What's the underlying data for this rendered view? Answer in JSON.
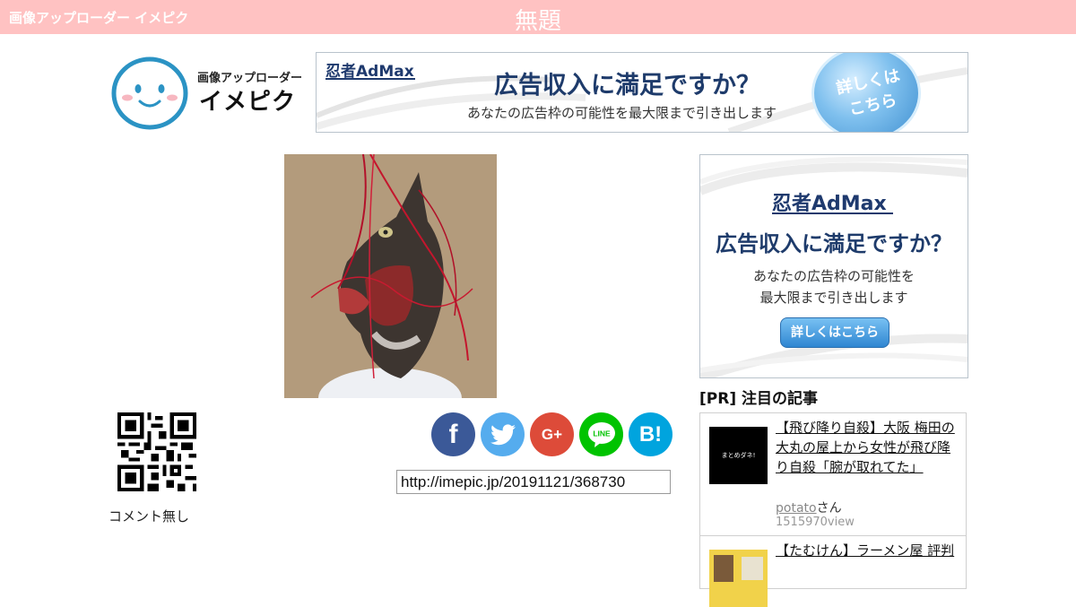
{
  "header": {
    "site_name": "画像アップローダー イメピク",
    "page_title": "無題"
  },
  "logo": {
    "small_text": "画像アップローダー",
    "big_text": "イメピク"
  },
  "top_ad": {
    "brand": "忍者AdMax",
    "headline": "広告収入に満足ですか？",
    "subtext": "あなたの広告枠の可能性を最大限まで引き出します",
    "circle_line1": "詳しくは",
    "circle_line2": "こちら"
  },
  "share": {
    "buttons": [
      {
        "name": "facebook",
        "label": "f",
        "color": "#3b5998"
      },
      {
        "name": "twitter",
        "label": "",
        "color": "#55acee"
      },
      {
        "name": "google-plus",
        "label": "G+",
        "color": "#dd4b39"
      },
      {
        "name": "line",
        "label": "LINE",
        "color": "#00c300"
      },
      {
        "name": "hatena-bookmark",
        "label": "B!",
        "color": "#00a4de"
      }
    ],
    "url": "http://imepic.jp/20191121/368730"
  },
  "comment": {
    "text": "コメント無し"
  },
  "side_ad": {
    "brand": "忍者AdMax",
    "headline": "広告収入に満足ですか？",
    "sub_line1": "あなたの広告枠の可能性を",
    "sub_line2": "最大限まで引き出します",
    "button": "詳しくはこちら"
  },
  "pr": {
    "heading": "[PR] 注目の記事",
    "articles": [
      {
        "thumb_text": "まとめダネ!",
        "title": "【飛び降り自殺】大阪 梅田の大丸の屋上から女性が飛び降り自殺「腕が取れてた」",
        "author": "potato",
        "author_suffix": "さん",
        "views": "1515970view"
      },
      {
        "title": "【たむけん】ラーメン屋 評判"
      }
    ]
  },
  "colors": {
    "topbar": "#ffc2c2",
    "logo_blue": "#2b93c4",
    "ad_navy": "#1e3b6b"
  }
}
